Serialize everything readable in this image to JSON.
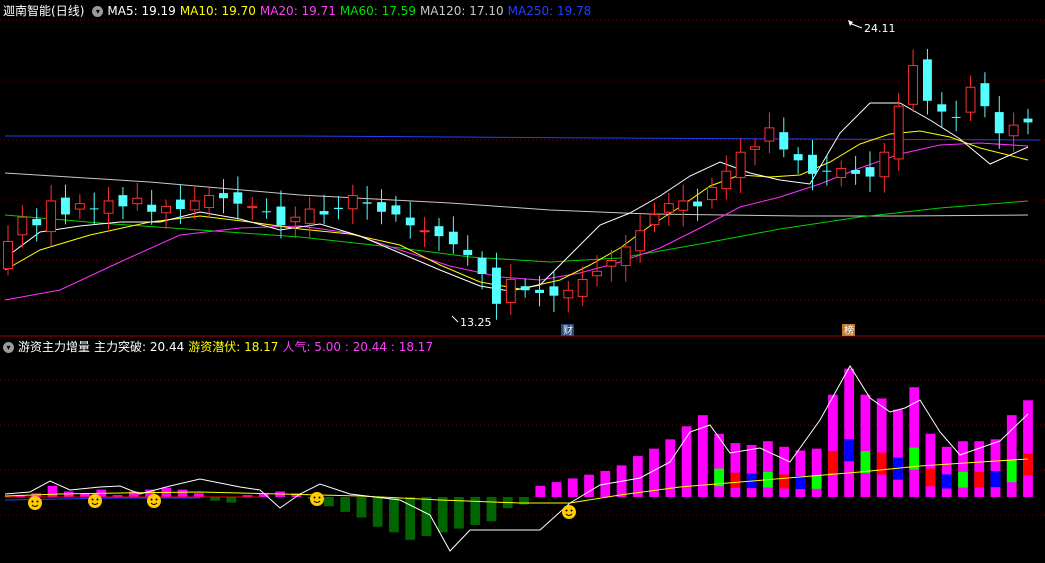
{
  "price_panel": {
    "stock_name": "迦南智能",
    "period": "(日线)",
    "ma_labels": [
      {
        "text": "MA5: 19.19",
        "color": "#ffffff"
      },
      {
        "text": "MA10: 19.70",
        "color": "#ffff00"
      },
      {
        "text": "MA20: 19.71",
        "color": "#ff40ff"
      },
      {
        "text": "MA60: 17.59",
        "color": "#00e000"
      },
      {
        "text": "MA120: 17.10",
        "color": "#c8c8c8"
      },
      {
        "text": "MA250: 19.78",
        "color": "#2040ff"
      }
    ],
    "high_label": "24.11",
    "low_label": "13.25",
    "marker_cai": "财",
    "marker_bang": "榜"
  },
  "indicator_panel": {
    "title": "游资主力增量",
    "labels": [
      {
        "text": "主力突破: 20.44",
        "color": "#ffffff"
      },
      {
        "text": "游资潜伏: 18.17",
        "color": "#ffff00"
      },
      {
        "text": "人气: 5.00 : 20.44 : 18.17",
        "color": "#ff40ff"
      }
    ]
  },
  "colors": {
    "up": "#ff3030",
    "down": "#54ffff",
    "grid": "#8b0000",
    "magenta": "#ff00ff",
    "green_bar": "#006400",
    "blue_bar": "#0000ff",
    "red_bar": "#ff0000",
    "lime_bar": "#00ff00"
  },
  "icons": {
    "collapse": "chevron-down-icon",
    "smiley": "smiley-icon"
  },
  "chart_data": [
    {
      "type": "candlestick",
      "title": "迦南智能 (日线)",
      "close": [
        16.0,
        16.9,
        16.6,
        17.5,
        17.0,
        17.4,
        17.2,
        17.5,
        17.3,
        17.6,
        17.1,
        17.3,
        17.2,
        17.5,
        17.7,
        17.6,
        17.4,
        17.3,
        17.1,
        16.6,
        16.9,
        17.2,
        17.0,
        17.2,
        17.7,
        17.4,
        17.1,
        17.0,
        16.6,
        16.4,
        16.2,
        15.9,
        15.5,
        14.8,
        13.7,
        14.6,
        14.2,
        14.1,
        14.0,
        14.2,
        14.6,
        14.9,
        15.3,
        15.8,
        16.4,
        17.0,
        17.4,
        17.5,
        17.3,
        18.0,
        18.6,
        19.3,
        19.5,
        20.2,
        19.4,
        19.0,
        18.5,
        18.6,
        18.7,
        18.5,
        18.4,
        19.3,
        21.0,
        22.5,
        21.2,
        20.8,
        20.6,
        21.7,
        21.0,
        20.0,
        20.3,
        20.4
      ],
      "ohlc_note": "approximate daily closes read from the candlestick chart",
      "high": 24.11,
      "low": 13.25,
      "ma": {
        "MA5": 19.19,
        "MA10": 19.7,
        "MA20": 19.71,
        "MA60": 17.59,
        "MA120": 17.1,
        "MA250": 19.78
      }
    },
    {
      "type": "bar",
      "title": "游资主力增量",
      "values": [
        0.2,
        0.4,
        1.2,
        0.6,
        0.4,
        0.8,
        0.2,
        0.6,
        0.8,
        1.0,
        0.8,
        0.4,
        -0.4,
        -0.6,
        0.2,
        0.4,
        0.6,
        0.4,
        -0.2,
        -1.0,
        -1.6,
        -2.2,
        -3.2,
        -3.8,
        -4.6,
        -4.2,
        -3.8,
        -3.4,
        -3.0,
        -2.6,
        -1.2,
        -0.8,
        1.2,
        1.6,
        2.0,
        2.4,
        2.8,
        3.4,
        4.4,
        5.2,
        6.2,
        7.6,
        8.8,
        6.8,
        5.8,
        5.6,
        6.0,
        5.4,
        5.0,
        5.2,
        11.0,
        13.8,
        11.0,
        10.6,
        9.4,
        11.8,
        6.8,
        5.4,
        6.0,
        6.0,
        6.2,
        8.8,
        10.4
      ],
      "series": [
        {
          "name": "主力突破",
          "value": 20.44
        },
        {
          "name": "游资潜伏",
          "value": 18.17
        },
        {
          "name": "人气",
          "value": 5.0
        }
      ]
    }
  ]
}
